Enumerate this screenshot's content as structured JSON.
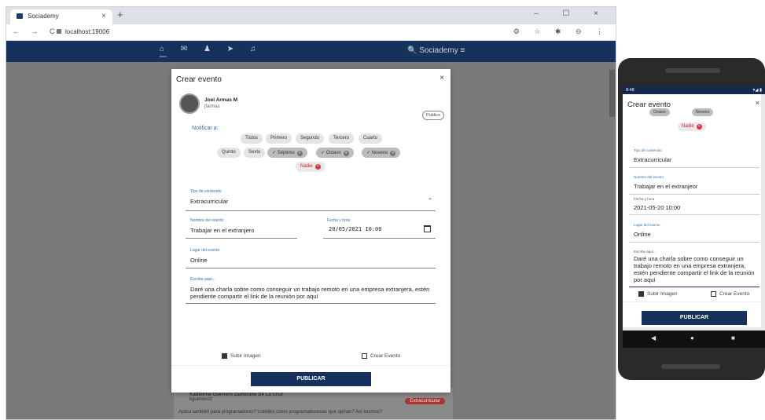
{
  "browser": {
    "tab_title": "Sociademy",
    "tab_close": "×",
    "new_tab": "+",
    "window_controls": "– ☐ ×",
    "nav_buttons": "← → C",
    "url": "localhost:19006",
    "toolbar_icons": "⚙ ☆ ✱ ⊖ ⋮"
  },
  "app": {
    "nav_icons": "⌂ ✉ ♟ ➤ ♫",
    "home_label": "Inicio",
    "brand": "🔍 Sociademy ≡"
  },
  "modal": {
    "title": "Crear evento",
    "close": "×",
    "user_name": "Joel Armas M",
    "user_handle": "jfarmas",
    "visibility": "Público",
    "notify_label": "Notificar a:",
    "chips": [
      "Todos",
      "Primero",
      "Segundo",
      "Tercero",
      "Cuarto",
      "Quinto",
      "Sexto"
    ],
    "selected_chips": [
      "Séptimo",
      "Octavo",
      "Noveno"
    ],
    "nadie": "Nadie",
    "content_type_label": "Tipo de contenido",
    "content_type_value": "Extracurricular",
    "event_name_label": "Nombre del evento",
    "event_name_value": "Trabajar en el extranjero",
    "datetime_label": "Fecha y hora",
    "datetime_value": "20/05/2021 10:00",
    "place_label": "Lugar del evento",
    "place_value": "Online",
    "description_label": "Escribe aquí...",
    "description_value": "Daré una charla sobre como conseguir un trabajo remoto en una empresa extranjera, estén pendiente compartir el link de la reunión por aquí",
    "upload_image": "Subir Imagen",
    "create_event": "Crear Evento",
    "publish": "PUBLICAR"
  },
  "feed": {
    "name": "Katherine Guerrero Zambrano De La Cruz",
    "handle": "kguerrero2",
    "badge": "Extracurricular",
    "text": "Aplica también para programadores? Ustedes cómo programadores/as que opinan? Así lucimos?"
  },
  "phone": {
    "time": "8:48",
    "status_right": "▾◢ ▮",
    "title": "Crear evento",
    "close": "×",
    "selected_chips": [
      "Octavo",
      "Noveno"
    ],
    "nadie": "Nadie",
    "content_type_label": "Tipo de contenido",
    "content_type_value": "Extracurricular",
    "event_name_label": "Nombre del evento",
    "event_name_value": "Trabajar en el extranjeor",
    "datetime_label": "Fecha y hora",
    "datetime_value": "2021-05-20 10:00",
    "place_label": "Lugar del evento",
    "place_value": "Online",
    "description_label": "Escribe aquí...",
    "description_value": "Daré una charla sobre como conseguir un trabajo remoto en una empresa extranjera, estén pendiente compartir el link de la reunión por aquí",
    "upload_image": "Subir Imagen",
    "create_event": "Crear Evento",
    "publish": "PUBLICAR",
    "nav_back": "◀",
    "nav_home": "●",
    "nav_recent": "■"
  }
}
